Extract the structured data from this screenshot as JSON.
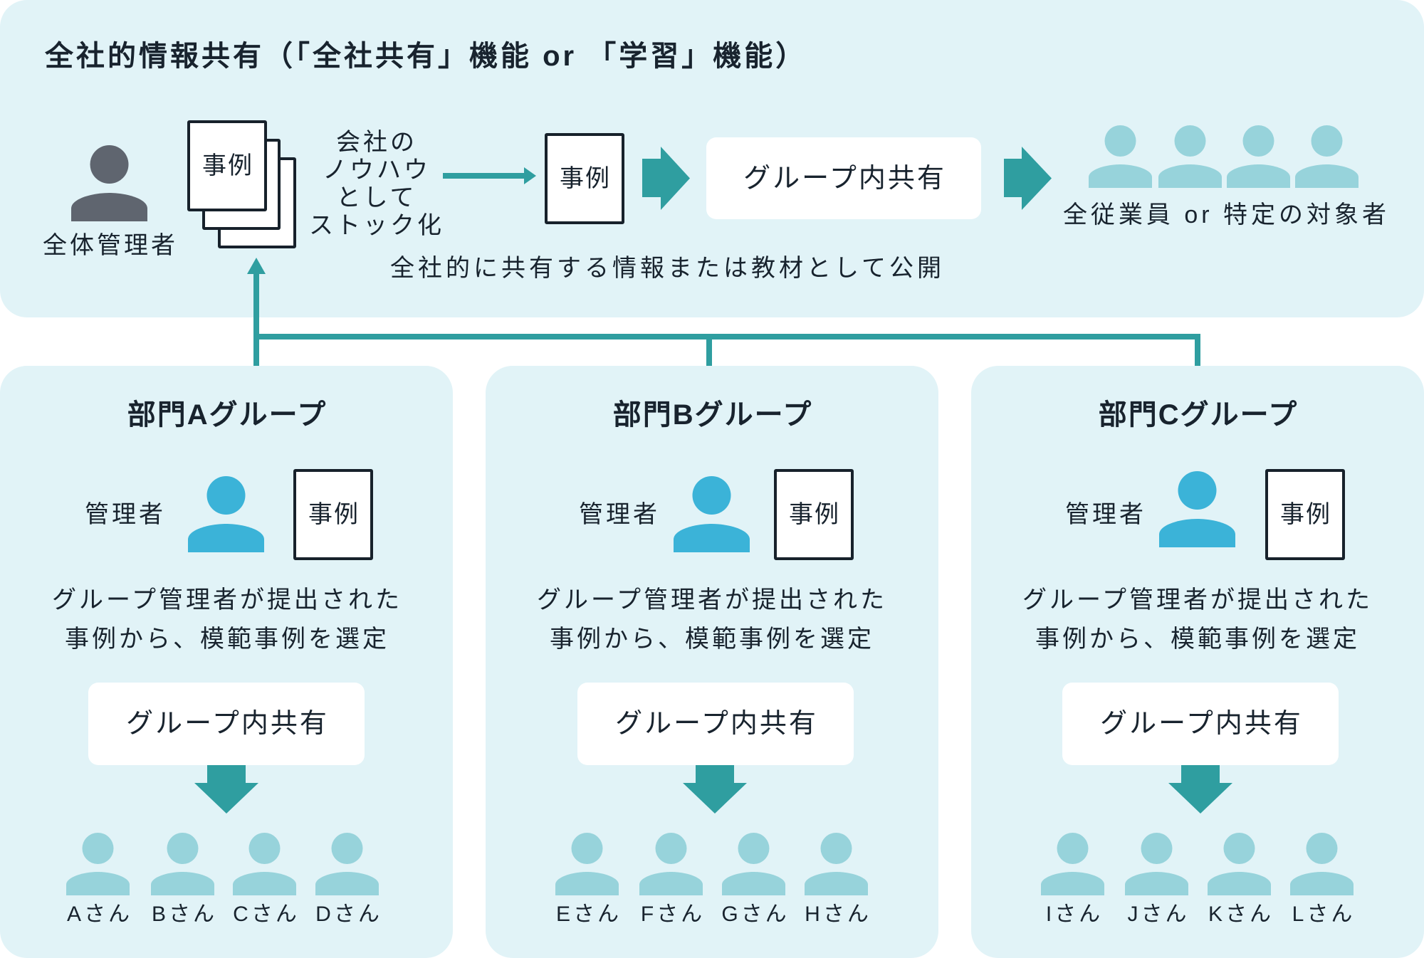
{
  "colors": {
    "panel_bg": "#e1f3f7",
    "teal": "#2f9ea0",
    "admin_icon": "#5f656f",
    "manager_icon": "#3bb3d8",
    "member_icon": "#97d3db",
    "text": "#18232e",
    "doc_border": "#17212b",
    "box_bg": "#ffffff"
  },
  "company": {
    "title": "全社的情報共有（「全社共有」機能 or 「学習」機能）",
    "admin": {
      "icon": "person-icon",
      "label": "全体管理者"
    },
    "stacked_docs": {
      "icon": "document-stack-icon",
      "label": "事例"
    },
    "stock_note": [
      "会社の",
      "ノウハウ",
      "として",
      "ストック化"
    ],
    "published_doc": {
      "icon": "document-icon",
      "label": "事例"
    },
    "share_box": "グループ内共有",
    "audience": {
      "icon": "people-group-icon",
      "count": 4,
      "label": "全従業員 or 特定の対象者"
    },
    "caption": "全社的に共有する情報または教材として公開"
  },
  "groups": [
    {
      "title": "部門Aグループ",
      "manager_label": "管理者",
      "doc_label": "事例",
      "description": [
        "グループ管理者が提出された",
        "事例から、模範事例を選定"
      ],
      "share_box": "グループ内共有",
      "members": [
        "Aさん",
        "Bさん",
        "Cさん",
        "Dさん"
      ]
    },
    {
      "title": "部門Bグループ",
      "manager_label": "管理者",
      "doc_label": "事例",
      "description": [
        "グループ管理者が提出された",
        "事例から、模範事例を選定"
      ],
      "share_box": "グループ内共有",
      "members": [
        "Eさん",
        "Fさん",
        "Gさん",
        "Hさん"
      ]
    },
    {
      "title": "部門Cグループ",
      "manager_label": "管理者",
      "doc_label": "事例",
      "description": [
        "グループ管理者が提出された",
        "事例から、模範事例を選定"
      ],
      "share_box": "グループ内共有",
      "members": [
        "Iさん",
        "Jさん",
        "Kさん",
        "Lさん"
      ]
    }
  ]
}
